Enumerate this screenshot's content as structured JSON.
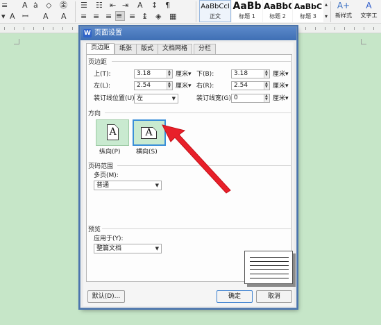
{
  "ribbon": {
    "styles": [
      {
        "sample": "AaBbCcI",
        "name": "正文",
        "active": true
      },
      {
        "sample": "AaBb",
        "name": "标题 1",
        "active": false
      },
      {
        "sample": "AaBbC",
        "name": "标题 2",
        "active": false
      },
      {
        "sample": "AaBbC",
        "name": "标题 3",
        "active": false
      }
    ],
    "new_style_label": "新样式",
    "text_tool_label": "文字工"
  },
  "dialog": {
    "title": "页面设置",
    "tabs": [
      "页边距",
      "纸张",
      "版式",
      "文档网格",
      "分栏"
    ],
    "active_tab": "页边距",
    "margins": {
      "section_title": "页边距",
      "top_label": "上(T):",
      "top_value": "3.18",
      "top_unit": "厘米",
      "bottom_label": "下(B):",
      "bottom_value": "3.18",
      "bottom_unit": "厘米",
      "left_label": "左(L):",
      "left_value": "2.54",
      "left_unit": "厘米",
      "right_label": "右(R):",
      "right_value": "2.54",
      "right_unit": "厘米",
      "gutter_pos_label": "装订线位置(U):",
      "gutter_pos_value": "左",
      "gutter_width_label": "装订线宽(G):",
      "gutter_width_value": "0",
      "gutter_width_unit": "厘米"
    },
    "orientation": {
      "section_title": "方向",
      "portrait_label": "纵向(P)",
      "landscape_label": "横向(S)",
      "selected": "横向(S)"
    },
    "pages": {
      "section_title": "页码范围",
      "multi_label": "多页(M):",
      "multi_value": "普通"
    },
    "preview": {
      "section_title": "预览",
      "apply_label": "应用于(Y):",
      "apply_value": "整篇文档"
    },
    "buttons": {
      "default": "默认(D)...",
      "ok": "确定",
      "cancel": "取消"
    }
  },
  "colors": {
    "background": "#c6e6c8",
    "arrow": "#e8202a",
    "selection": "#3a8fd8"
  }
}
